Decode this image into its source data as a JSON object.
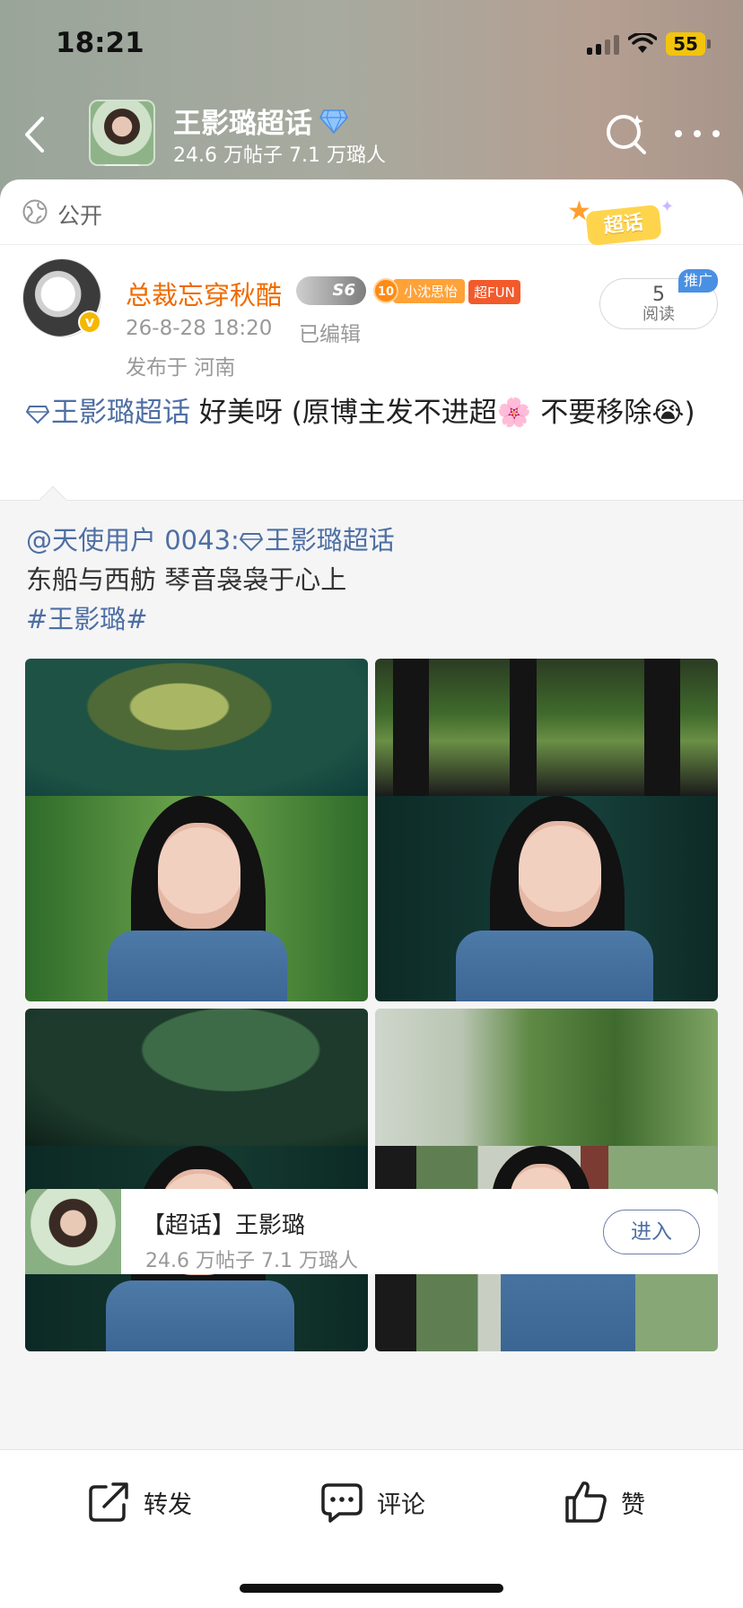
{
  "status_bar": {
    "time": "18:21",
    "battery": "55"
  },
  "header": {
    "topic_title": "王影璐超话",
    "topic_stats": "24.6 万帖子 7.1 万璐人"
  },
  "visibility": {
    "label": "公开",
    "badge": "超话"
  },
  "post": {
    "author": "总裁忘穿秋酷",
    "rank_badge": "S6",
    "fan_level": "10",
    "fan_badge": "小沈思怡",
    "superfun_badge": "超FUN",
    "time": "26-8-28 18:20",
    "edited": "已编辑",
    "location": "发布于 河南",
    "reads_count": "5",
    "reads_label": "阅读",
    "promo": "推广",
    "topic_link": "王影璐超话",
    "text": " 好美呀 (原博主发不进超🌸 不要移除😭)"
  },
  "repost": {
    "mention": "@天使用户 0043:",
    "topic_link": "王影璐超话",
    "line2": "东船与西舫 琴音袅袅于心上",
    "hashtag": "#王影璐#",
    "images": [
      {
        "alt": "photo-1"
      },
      {
        "alt": "photo-2"
      },
      {
        "alt": "photo-3"
      },
      {
        "alt": "photo-4"
      }
    ]
  },
  "topic_card": {
    "title": "【超话】王影璐",
    "stats": "24.6 万帖子 7.1 万璐人",
    "enter_label": "进入"
  },
  "actions": {
    "repost_label": "转发",
    "comment_label": "评论",
    "like_label": "赞"
  },
  "colors": {
    "link": "#4e6fa3",
    "author": "#f06a00",
    "battery": "#f2c40d"
  }
}
